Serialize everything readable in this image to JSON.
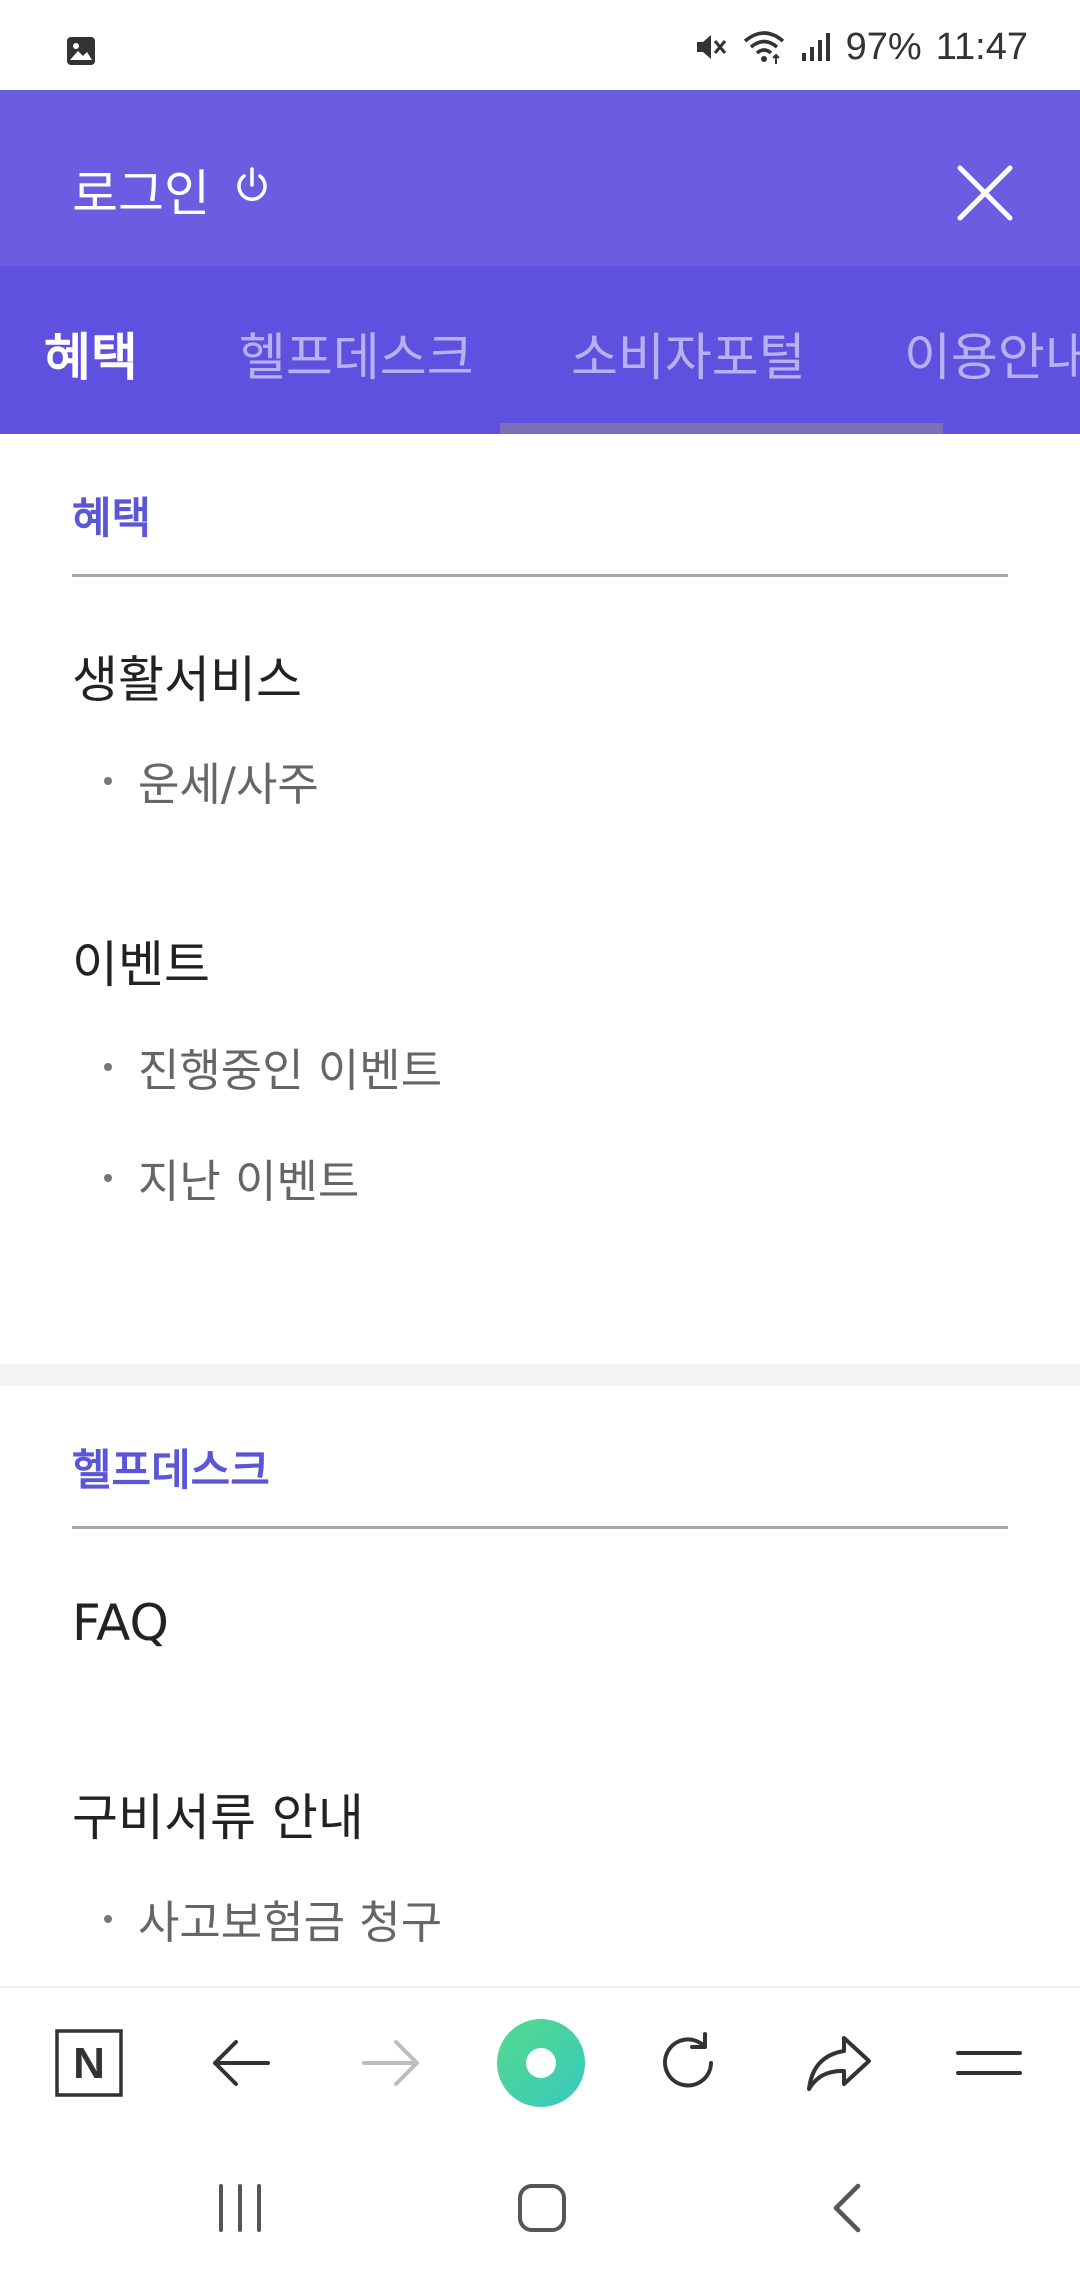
{
  "status_bar": {
    "battery": "97%",
    "time": "11:47"
  },
  "header": {
    "login_label": "로그인"
  },
  "tabs": [
    {
      "label": "혜택",
      "active": true
    },
    {
      "label": "헬프데스크",
      "active": false
    },
    {
      "label": "소비자포털",
      "active": false
    },
    {
      "label": "이용안내",
      "active": false
    }
  ],
  "sections": [
    {
      "title": "혜택",
      "groups": [
        {
          "title": "생활서비스",
          "items": [
            "운세/사주"
          ]
        },
        {
          "title": "이벤트",
          "items": [
            "진행중인 이벤트",
            "지난 이벤트"
          ]
        }
      ]
    },
    {
      "title": "헬프데스크",
      "groups": [
        {
          "title": "FAQ",
          "items": []
        },
        {
          "title": "구비서류 안내",
          "items": [
            "사고보험금 청구"
          ]
        }
      ]
    }
  ],
  "toolbar": {
    "icons": [
      "naver-n-icon",
      "back-arrow-icon",
      "forward-arrow-icon",
      "green-dot-icon",
      "refresh-icon",
      "share-icon",
      "menu-icon"
    ],
    "home_logo_letter": "N"
  },
  "colors": {
    "header_bg": "#6c5ce2",
    "tab_bg": "#5f51df",
    "section_title": "#5b56d6",
    "green_dot_gradient": [
      "#56d98a",
      "#3ccfb0"
    ]
  }
}
